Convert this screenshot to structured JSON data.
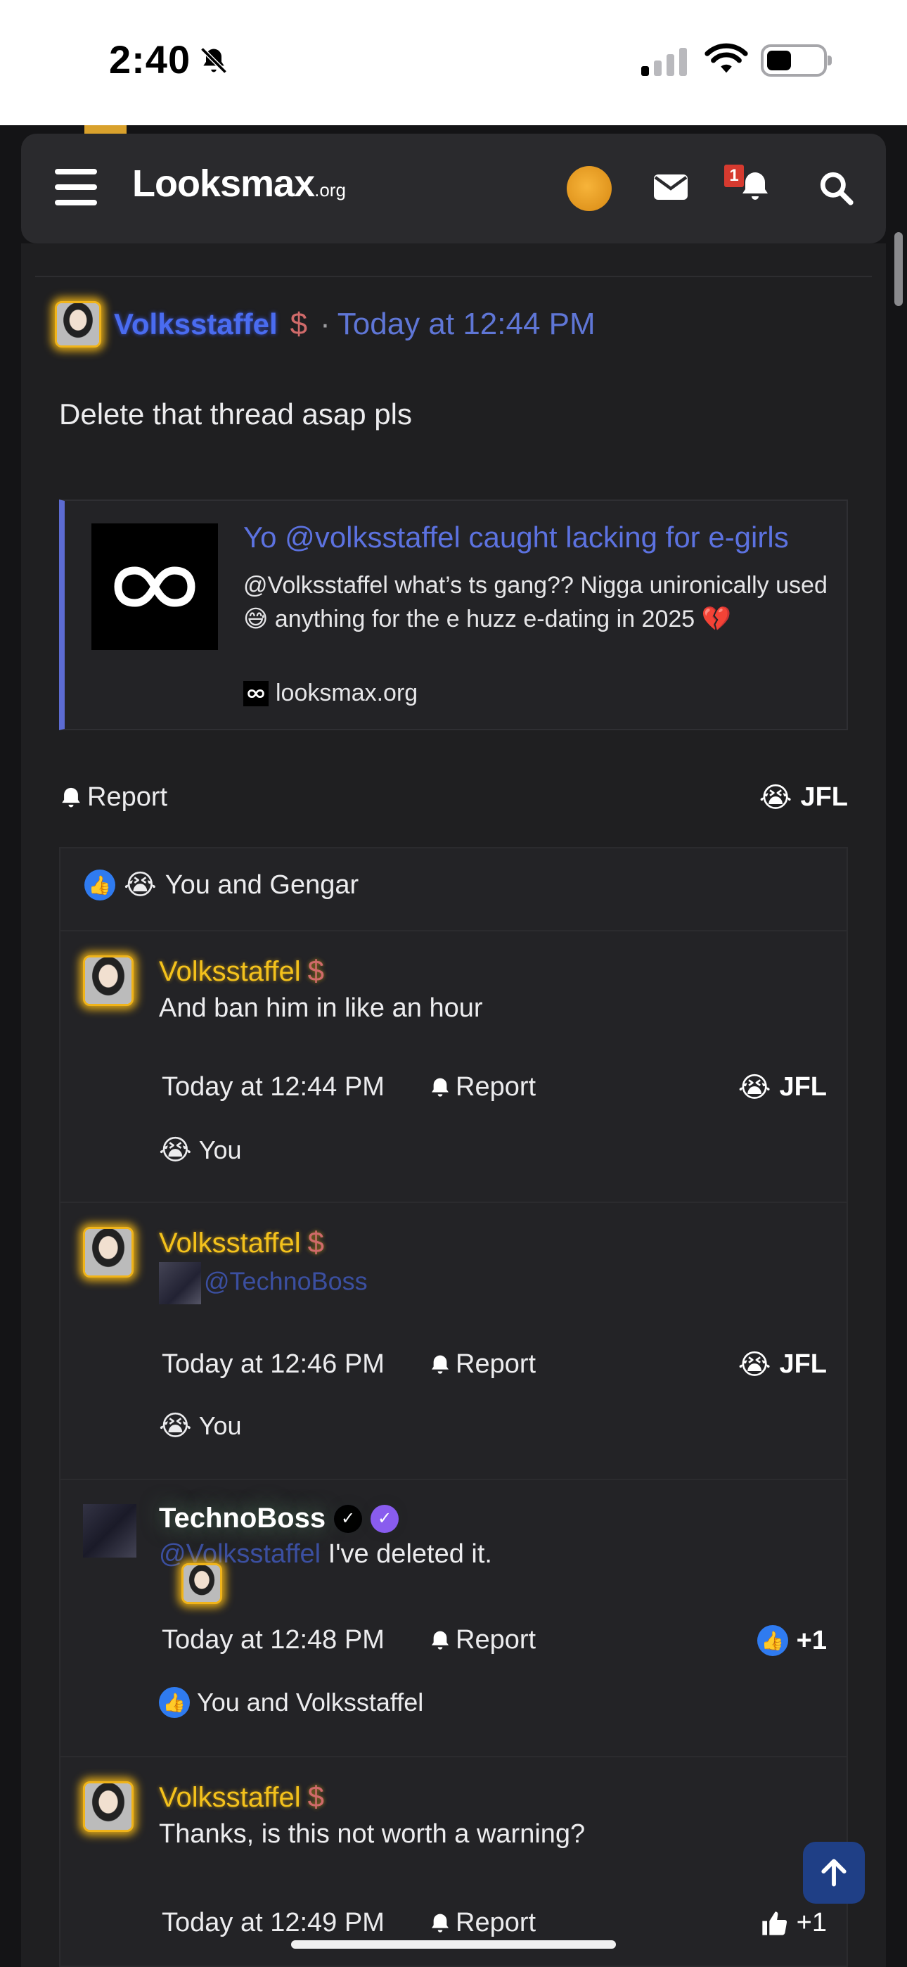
{
  "status_bar": {
    "time": "2:40"
  },
  "header": {
    "logo": "Looksmax",
    "logo_suffix": ".org",
    "notification_count": "1"
  },
  "post": {
    "username": "Volksstaffel",
    "date": "Today at 12:44 PM",
    "text": "Delete that thread asap pls",
    "embed": {
      "title": "Yo @volksstaffel caught lacking for e-girls",
      "description": "@Volksstaffel what’s ts gang?? Nigga unironically used 😅 anything for the e huzz e-dating in 2025 💔",
      "site": "looksmax.org"
    },
    "report_label": "Report",
    "reaction_label": "JFL",
    "reactions_summary": "You and Gengar"
  },
  "replies": [
    {
      "username": "Volksstaffel",
      "text": "And ban him in like an hour",
      "time": "Today at 12:44 PM",
      "report": "Report",
      "reaction": "JFL",
      "who": "You"
    },
    {
      "username": "Volksstaffel",
      "mention": "@TechnoBoss",
      "time": "Today at 12:46 PM",
      "report": "Report",
      "reaction": "JFL",
      "who": "You"
    },
    {
      "username": "TechnoBoss",
      "mention": "@Volksstaffel",
      "text": " I've deleted it.",
      "time": "Today at 12:48 PM",
      "report": "Report",
      "reaction": "+1",
      "who": "You and Volksstaffel"
    },
    {
      "username": "Volksstaffel",
      "text": "Thanks, is this not worth a warning?",
      "time": "Today at 12:49 PM",
      "report": "Report",
      "reaction": "+1"
    }
  ],
  "colors": {
    "accent": "#5c72e0",
    "gold": "#f4c21c",
    "background": "#1f1f21"
  }
}
